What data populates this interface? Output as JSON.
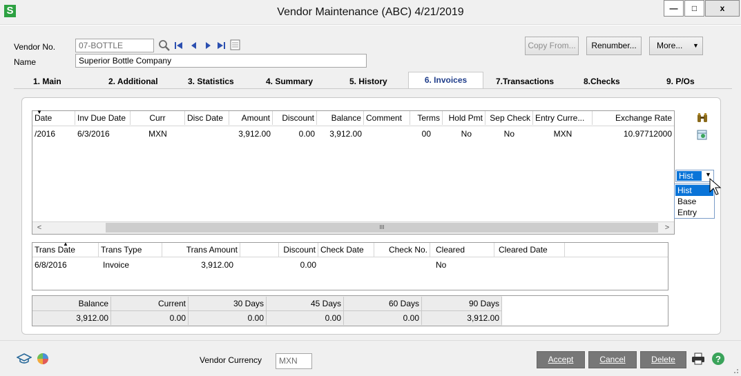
{
  "window": {
    "logo": "S",
    "title": "Vendor Maintenance (ABC) 4/21/2019",
    "minimize": "—",
    "maximize": "□",
    "close": "x"
  },
  "header": {
    "vendor_no_label": "Vendor No.",
    "vendor_no_value": "07-BOTTLE",
    "name_label": "Name",
    "name_value": "Superior Bottle Company",
    "copy_from": "Copy From...",
    "renumber": "Renumber...",
    "more": "More...",
    "more_arrow": "▼"
  },
  "tabs": [
    {
      "label": "1. Main"
    },
    {
      "label": "2. Additional"
    },
    {
      "label": "3. Statistics"
    },
    {
      "label": "4. Summary"
    },
    {
      "label": "5. History"
    },
    {
      "label": "6. Invoices"
    },
    {
      "label": "7.Transactions"
    },
    {
      "label": "8.Checks"
    },
    {
      "label": "9. P/Os"
    }
  ],
  "invoices_grid": {
    "headers": [
      "Date",
      "Inv Due Date",
      "Curr",
      "Disc Date",
      "Amount",
      "Discount",
      "Balance",
      "Comment",
      "Terms",
      "Hold Pmt",
      "Sep Check",
      "Entry Curre...",
      "Exchange Rate"
    ],
    "rows": [
      [
        "/2016",
        "6/3/2016",
        "MXN",
        "",
        "3,912.00",
        "0.00",
        "3,912.00",
        "",
        "00",
        "No",
        "No",
        "MXN",
        "10.97712000"
      ]
    ],
    "scroll_left": "<",
    "scroll_right": ">",
    "scroll_grip": "III"
  },
  "currency_dropdown": {
    "selected": "Hist",
    "arrow": "▼",
    "options": [
      "Hist",
      "Base",
      "Entry"
    ]
  },
  "trans_grid": {
    "headers": [
      "Trans Date",
      "Trans Type",
      "Trans Amount",
      "",
      "Discount",
      "Check Date",
      "Check No.",
      "Cleared",
      "Cleared Date"
    ],
    "rows": [
      [
        "6/8/2016",
        "Invoice",
        "3,912.00",
        "",
        "0.00",
        "",
        "",
        "No",
        ""
      ]
    ]
  },
  "aging_grid": {
    "headers": [
      "Balance",
      "Current",
      "30 Days",
      "45 Days",
      "60 Days",
      "90 Days"
    ],
    "values": [
      "3,912.00",
      "0.00",
      "0.00",
      "0.00",
      "0.00",
      "3,912.00"
    ]
  },
  "footer": {
    "vendor_currency_label": "Vendor Currency",
    "vendor_currency_value": "MXN",
    "accept": "Accept",
    "cancel": "Cancel",
    "delete": "Delete"
  }
}
